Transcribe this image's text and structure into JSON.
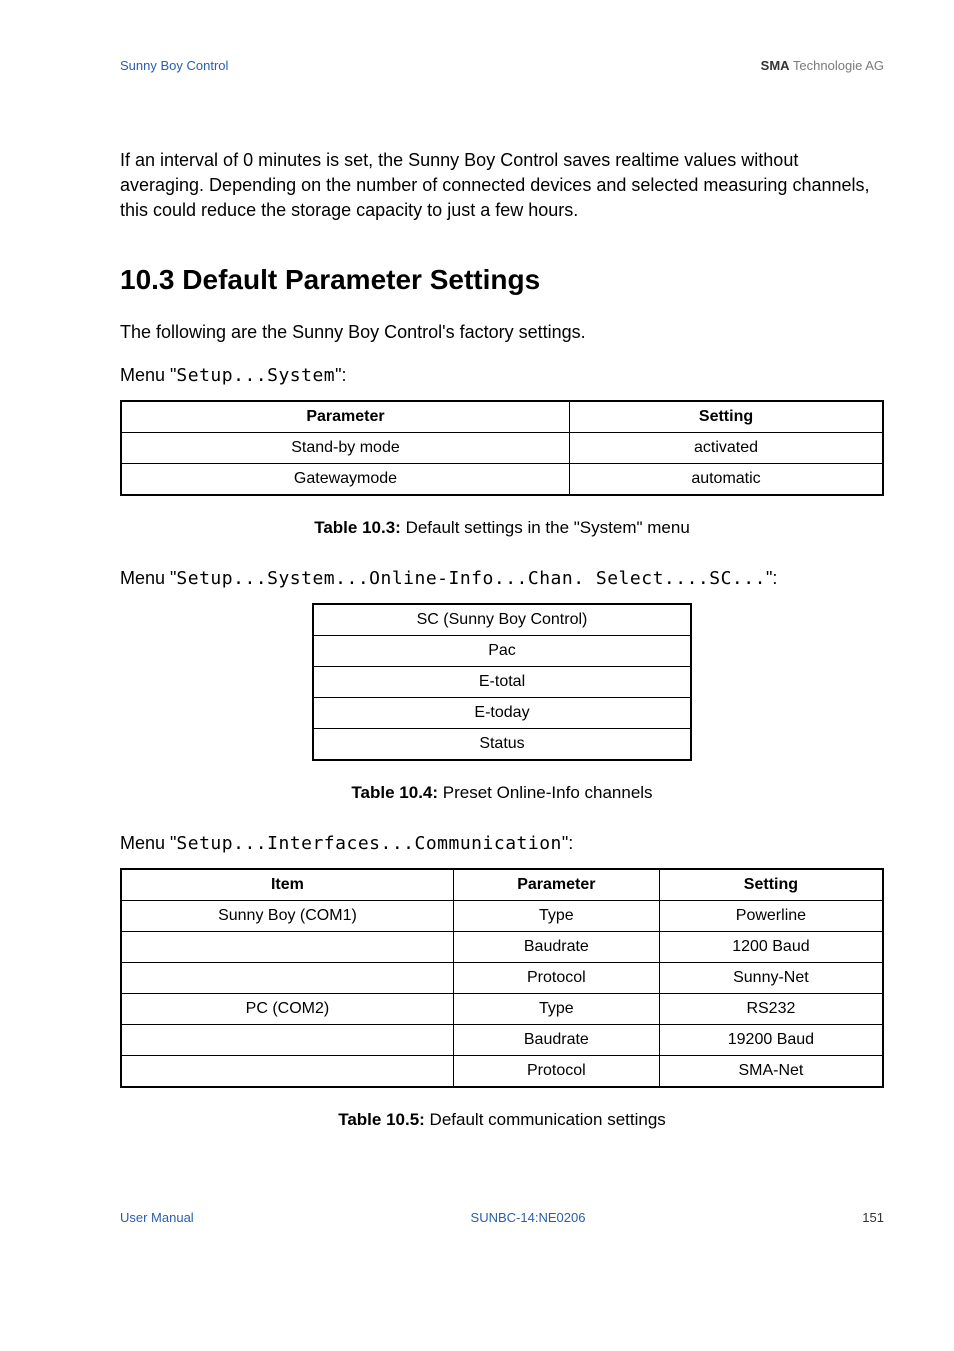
{
  "header": {
    "left": "Sunny Boy Control",
    "right_brand": "SMA",
    "right_suffix": " Technologie AG"
  },
  "intro_paragraph": "If an interval of 0 minutes is set, the Sunny Boy Control saves realtime values without averaging. Depending on the number of connected devices and selected measuring channels, this could reduce the storage capacity to just a few hours.",
  "section_heading": "10.3 Default Parameter Settings",
  "section_intro": "The following are the Sunny Boy Control's factory settings.",
  "menu1": {
    "prefix": "Menu \"",
    "code": "Setup...System",
    "suffix": "\":"
  },
  "table1": {
    "headers": [
      "Parameter",
      "Setting"
    ],
    "rows": [
      [
        "Stand-by mode",
        "activated"
      ],
      [
        "Gatewaymode",
        "automatic"
      ]
    ]
  },
  "caption1": {
    "label": "Table 10.3:",
    "text": " Default settings in the \"System\" menu"
  },
  "menu2": {
    "prefix": "Menu \"",
    "code": "Setup...System...Online-Info...Chan. Select....SC...",
    "suffix": "\":"
  },
  "table2": {
    "rows": [
      "SC (Sunny Boy Control)",
      "Pac",
      "E-total",
      "E-today",
      "Status"
    ]
  },
  "caption2": {
    "label": "Table 10.4:",
    "text": " Preset Online-Info channels"
  },
  "menu3": {
    "prefix": "Menu \"",
    "code": "Setup...Interfaces...Communication",
    "suffix": "\":"
  },
  "table3": {
    "headers": [
      "Item",
      "Parameter",
      "Setting"
    ],
    "rows": [
      [
        "Sunny Boy (COM1)",
        "Type",
        "Powerline"
      ],
      [
        "",
        "Baudrate",
        "1200 Baud"
      ],
      [
        "",
        "Protocol",
        "Sunny-Net"
      ],
      [
        "PC (COM2)",
        "Type",
        "RS232"
      ],
      [
        "",
        "Baudrate",
        "19200 Baud"
      ],
      [
        "",
        "Protocol",
        "SMA-Net"
      ]
    ]
  },
  "caption3": {
    "label": "Table 10.5:",
    "text": " Default communication settings"
  },
  "footer": {
    "left": "User Manual",
    "center": "SUNBC-14:NE0206",
    "right": "151"
  }
}
